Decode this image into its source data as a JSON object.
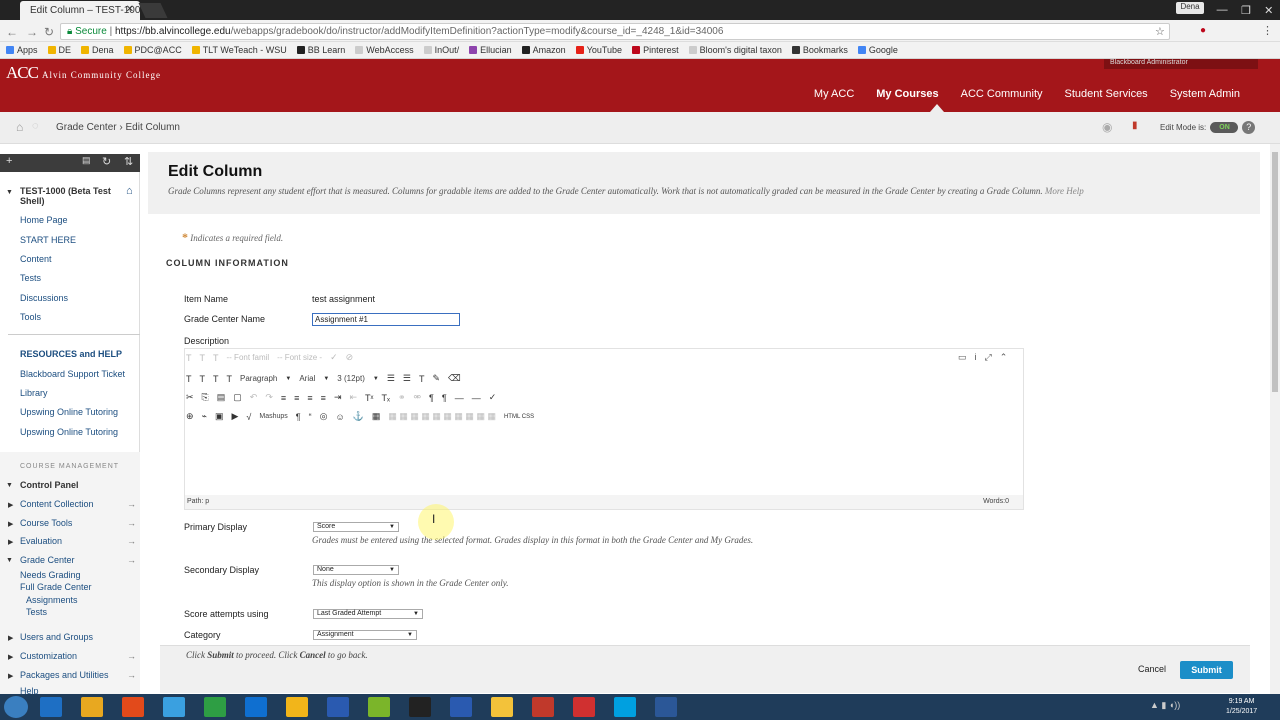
{
  "browser": {
    "tab_title": "Edit Column – TEST-1000",
    "user": "Dena",
    "secure_label": "Secure",
    "url_host": "https://bb.alvincollege.edu",
    "url_path": "/webapps/gradebook/do/instructor/addModifyItemDefinition?actionType=modify&course_id=_4248_1&id=34006",
    "bookmarks": [
      {
        "label": "Apps",
        "color": "#4285f4"
      },
      {
        "label": "DE",
        "color": "#f0b400"
      },
      {
        "label": "Dena",
        "color": "#f0b400"
      },
      {
        "label": "PDC@ACC",
        "color": "#f0b400"
      },
      {
        "label": "TLT WeTeach - WSU",
        "color": "#f0b400"
      },
      {
        "label": "BB Learn",
        "color": "#222"
      },
      {
        "label": "WebAccess",
        "color": "#ccc"
      },
      {
        "label": "InOut/",
        "color": "#ccc"
      },
      {
        "label": "Ellucian",
        "color": "#8e44ad"
      },
      {
        "label": "Amazon",
        "color": "#222"
      },
      {
        "label": "YouTube",
        "color": "#e62117"
      },
      {
        "label": "Pinterest",
        "color": "#bd081c"
      },
      {
        "label": "Bloom's digital taxon",
        "color": "#ccc"
      },
      {
        "label": "Bookmarks",
        "color": "#333"
      },
      {
        "label": "Google",
        "color": "#4285f4"
      }
    ]
  },
  "header": {
    "logo": "ACC",
    "logo_sub": "Alvin Community College",
    "admin": "Blackboard Administrator",
    "nav": [
      "My ACC",
      "My Courses",
      "ACC Community",
      "Student Services",
      "System Admin"
    ],
    "active_nav": "My Courses"
  },
  "breadcrumb": {
    "parent": "Grade Center",
    "current": "Edit Column"
  },
  "edit_mode": {
    "label": "Edit Mode is:",
    "state": "ON"
  },
  "sidebar": {
    "course_title": "TEST-1000 (Beta Test Shell)",
    "links": [
      "Home Page",
      "START HERE",
      "Content",
      "Tests",
      "Discussions",
      "Tools"
    ],
    "resources_head": "RESOURCES and HELP",
    "resources": [
      "Blackboard Support Ticket",
      "Library",
      "Upswing Online Tutoring",
      "Upswing Online Tutoring"
    ],
    "course_mgmt": "COURSE MANAGEMENT",
    "control_panel": "Control Panel",
    "cp_items": [
      "Content Collection",
      "Course Tools",
      "Evaluation",
      "Grade Center"
    ],
    "gc_sub": [
      "Needs Grading",
      "Full Grade Center"
    ],
    "gc_subsub": [
      "Assignments",
      "Tests"
    ],
    "cp_items2": [
      "Users and Groups",
      "Customization",
      "Packages and Utilities",
      "Help"
    ]
  },
  "page": {
    "title": "Edit Column",
    "description": "Grade Columns represent any student effort that is measured. Columns for gradable items are added to the Grade Center automatically. Work that is not automatically graded can be measured in the Grade Center by creating a Grade Column.",
    "more_help": "More Help",
    "required_note": "Indicates a required field.",
    "section": "COLUMN INFORMATION"
  },
  "form": {
    "item_name_label": "Item Name",
    "item_name": "test assignment",
    "gc_name_label": "Grade Center Name",
    "gc_name": "Assignment #1",
    "description_label": "Description",
    "editor": {
      "font_family": "-- Font famil",
      "font_size": "-- Font size -",
      "paragraph": "Paragraph",
      "font": "Arial",
      "size": "3 (12pt)",
      "mashups": "Mashups",
      "html_css": "HTML CSS",
      "path": "Path: p",
      "words": "Words:0"
    },
    "primary_label": "Primary Display",
    "primary_value": "Score",
    "primary_hint": "Grades must be entered using the selected format. Grades display in this format in both the Grade Center and My Grades.",
    "secondary_label": "Secondary Display",
    "secondary_value": "None",
    "secondary_hint": "This display option is shown in the Grade Center only.",
    "attempts_label": "Score attempts using",
    "attempts_value": "Last Graded Attempt",
    "category_label": "Category",
    "category_value": "Assignment"
  },
  "submit_bar": {
    "hint_pre": "Click ",
    "hint_submit": "Submit",
    "hint_mid": " to proceed. Click ",
    "hint_cancel": "Cancel",
    "hint_post": " to go back.",
    "cancel": "Cancel",
    "submit": "Submit"
  },
  "taskbar": {
    "time": "9:19 AM",
    "date": "1/25/2017"
  }
}
